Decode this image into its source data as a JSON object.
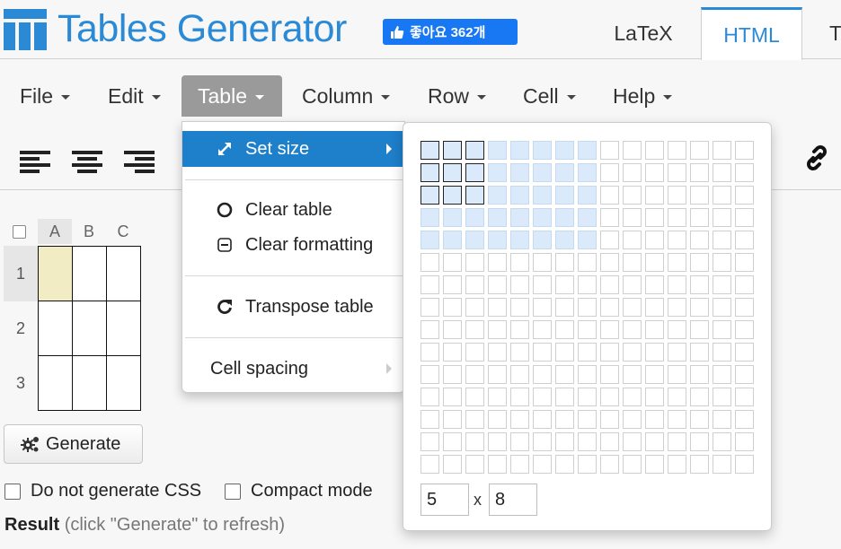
{
  "header": {
    "brand": "Tables Generator",
    "facebook_like": "좋아요 362개",
    "tabs": [
      {
        "label": "LaTeX",
        "active": false
      },
      {
        "label": "HTML",
        "active": true
      },
      {
        "label": "T",
        "active": false
      }
    ],
    "accent_color": "#2b8ad6"
  },
  "menubar": {
    "items": [
      "File",
      "Edit",
      "Table",
      "Column",
      "Row",
      "Cell",
      "Help"
    ],
    "open_menu": "Table"
  },
  "toolbar": {
    "icons": [
      "align-left-icon",
      "align-center-icon",
      "align-right-icon",
      "link-icon"
    ]
  },
  "editor": {
    "columns": [
      "A",
      "B",
      "C"
    ],
    "rows": [
      "1",
      "2",
      "3"
    ],
    "selected_cell": "A1",
    "selected_color": "#f1ecc4"
  },
  "generate_label": "Generate",
  "options": {
    "no_css": "Do not generate CSS",
    "compact": "Compact mode"
  },
  "result": {
    "label": "Result",
    "hint": "(click \"Generate\" to refresh)"
  },
  "table_menu": {
    "set_size": "Set size",
    "clear_table": "Clear table",
    "clear_formatting": "Clear formatting",
    "transpose": "Transpose table",
    "cell_spacing": "Cell spacing",
    "highlight_color": "#1e7fcb"
  },
  "size_picker": {
    "grid_cols": 15,
    "grid_rows": 15,
    "current_rows": 3,
    "current_cols": 3,
    "hover_rows": 5,
    "hover_cols": 8,
    "rows_value": "5",
    "separator": "x",
    "cols_value": "8"
  }
}
